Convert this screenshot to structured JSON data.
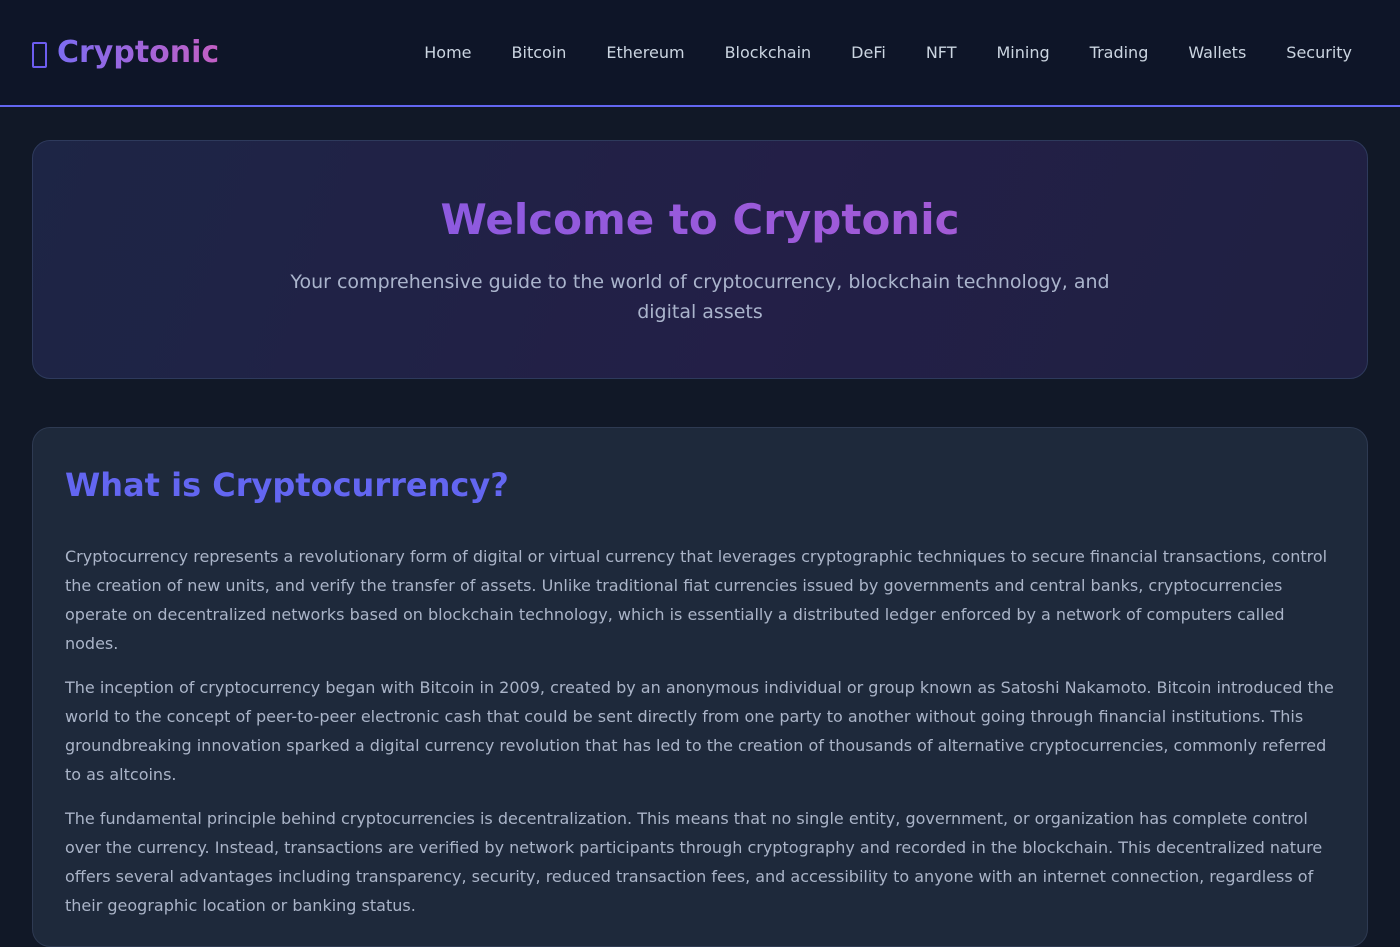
{
  "header": {
    "logo_icon": "wallet-icon",
    "logo_text": "Cryptonic",
    "nav": [
      {
        "label": "Home"
      },
      {
        "label": "Bitcoin"
      },
      {
        "label": "Ethereum"
      },
      {
        "label": "Blockchain"
      },
      {
        "label": "DeFi"
      },
      {
        "label": "NFT"
      },
      {
        "label": "Mining"
      },
      {
        "label": "Trading"
      },
      {
        "label": "Wallets"
      },
      {
        "label": "Security"
      }
    ]
  },
  "hero": {
    "title": "Welcome to Cryptonic",
    "subtitle": "Your comprehensive guide to the world of cryptocurrency, blockchain technology, and digital assets"
  },
  "section": {
    "title": "What is Cryptocurrency?",
    "paragraphs": [
      "Cryptocurrency represents a revolutionary form of digital or virtual currency that leverages cryptographic techniques to secure financial transactions, control the creation of new units, and verify the transfer of assets. Unlike traditional fiat currencies issued by governments and central banks, cryptocurrencies operate on decentralized networks based on blockchain technology, which is essentially a distributed ledger enforced by a network of computers called nodes.",
      "The inception of cryptocurrency began with Bitcoin in 2009, created by an anonymous individual or group known as Satoshi Nakamoto. Bitcoin introduced the world to the concept of peer-to-peer electronic cash that could be sent directly from one party to another without going through financial institutions. This groundbreaking innovation sparked a digital currency revolution that has led to the creation of thousands of alternative cryptocurrencies, commonly referred to as altcoins.",
      "The fundamental principle behind cryptocurrencies is decentralization. This means that no single entity, government, or organization has complete control over the currency. Instead, transactions are verified by network participants through cryptography and recorded in the blockchain. This decentralized nature offers several advantages including transparency, security, reduced transaction fees, and accessibility to anyone with an internet connection, regardless of their geographic location or banking status."
    ]
  },
  "colors": {
    "accent": "#6366f1",
    "gradient_end": "#c35fc4",
    "background": "#111827",
    "card": "#1e293b"
  }
}
